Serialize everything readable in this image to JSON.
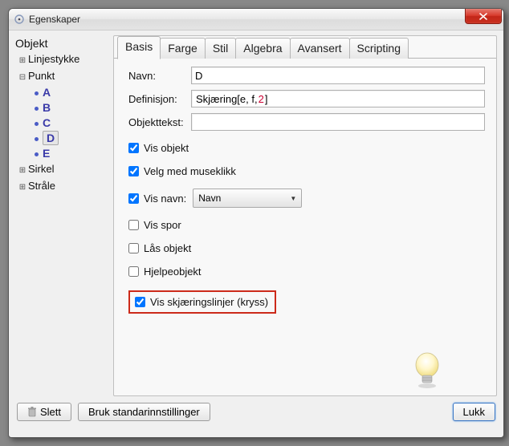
{
  "window": {
    "title": "Egenskaper"
  },
  "tree": {
    "heading": "Objekt",
    "items": {
      "linjestykke": "Linjestykke",
      "punkt": "Punkt",
      "points": [
        "A",
        "B",
        "C",
        "D",
        "E"
      ],
      "sirkel": "Sirkel",
      "strale": "Stråle"
    },
    "selected_point": "D"
  },
  "tabs": {
    "basis": "Basis",
    "farge": "Farge",
    "stil": "Stil",
    "algebra": "Algebra",
    "avansert": "Avansert",
    "scripting": "Scripting"
  },
  "form": {
    "navn_label": "Navn:",
    "navn_value": "D",
    "definisjon_label": "Definisjon:",
    "definisjon_prefix": "Skjæring[e, f, ",
    "definisjon_arg": "2",
    "definisjon_suffix": "]",
    "objekttekst_label": "Objekttekst:",
    "objekttekst_value": ""
  },
  "checkboxes": {
    "vis_objekt": {
      "label": "Vis objekt",
      "checked": true
    },
    "velg_museklikk": {
      "label": "Velg med museklikk",
      "checked": true
    },
    "vis_navn": {
      "label": "Vis navn:",
      "checked": true,
      "select_value": "Navn"
    },
    "vis_spor": {
      "label": "Vis spor",
      "checked": false
    },
    "las_objekt": {
      "label": "Lås objekt",
      "checked": false
    },
    "hjelpeobjekt": {
      "label": "Hjelpeobjekt",
      "checked": false
    },
    "vis_skjaering": {
      "label": "Vis skjæringslinjer (kryss)",
      "checked": true
    }
  },
  "buttons": {
    "slett": "Slett",
    "standard": "Bruk standarinnstillinger",
    "lukk": "Lukk"
  }
}
